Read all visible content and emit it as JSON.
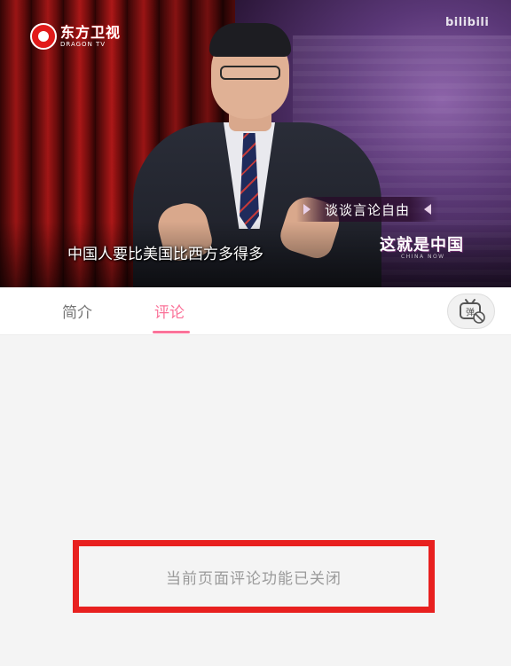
{
  "video": {
    "broadcaster_logo_text": "东方卫视",
    "broadcaster_logo_subtext": "DRAGON TV",
    "watermark": "bilibili",
    "topic_banner": "谈谈言论自由",
    "show_title": "这就是中国",
    "show_subtitle": "CHINA NOW",
    "subtitle": "中国人要比美国比西方多得多"
  },
  "tabs": [
    {
      "label": "简介",
      "active": false
    },
    {
      "label": "评论",
      "active": true
    }
  ],
  "danmaku_toggle": {
    "icon": "danmaku-off-icon",
    "glyph": "弹"
  },
  "comments": {
    "disabled_message": "当前页面评论功能已关闭"
  },
  "colors": {
    "accent": "#fb7299",
    "highlight_border": "#e8201f",
    "page_bg": "#f4f4f4"
  }
}
